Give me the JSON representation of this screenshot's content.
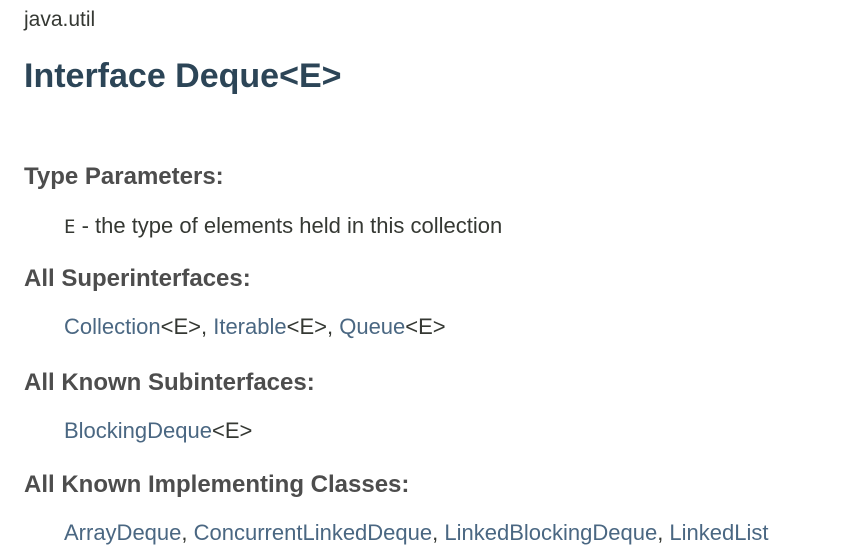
{
  "package_name": "java.util",
  "title": "Interface Deque<E>",
  "type_parameters": {
    "label": "Type Parameters:",
    "param": "E",
    "description": " - the type of elements held in this collection"
  },
  "superinterfaces": {
    "label": "All Superinterfaces:",
    "items": [
      {
        "name": "Collection",
        "generic": "<E>",
        "sep": ", "
      },
      {
        "name": "Iterable",
        "generic": "<E>",
        "sep": ", "
      },
      {
        "name": "Queue",
        "generic": "<E>",
        "sep": ""
      }
    ]
  },
  "subinterfaces": {
    "label": "All Known Subinterfaces:",
    "items": [
      {
        "name": "BlockingDeque",
        "generic": "<E>",
        "sep": ""
      }
    ]
  },
  "implementing_classes": {
    "label": "All Known Implementing Classes:",
    "items": [
      {
        "name": "ArrayDeque",
        "sep": ", "
      },
      {
        "name": "ConcurrentLinkedDeque",
        "sep": ", "
      },
      {
        "name": "LinkedBlockingDeque",
        "sep": ", "
      },
      {
        "name": "LinkedList",
        "sep": ""
      }
    ]
  },
  "colors": {
    "link": "#4a6782",
    "title": "#2c4557",
    "text": "#353833"
  }
}
